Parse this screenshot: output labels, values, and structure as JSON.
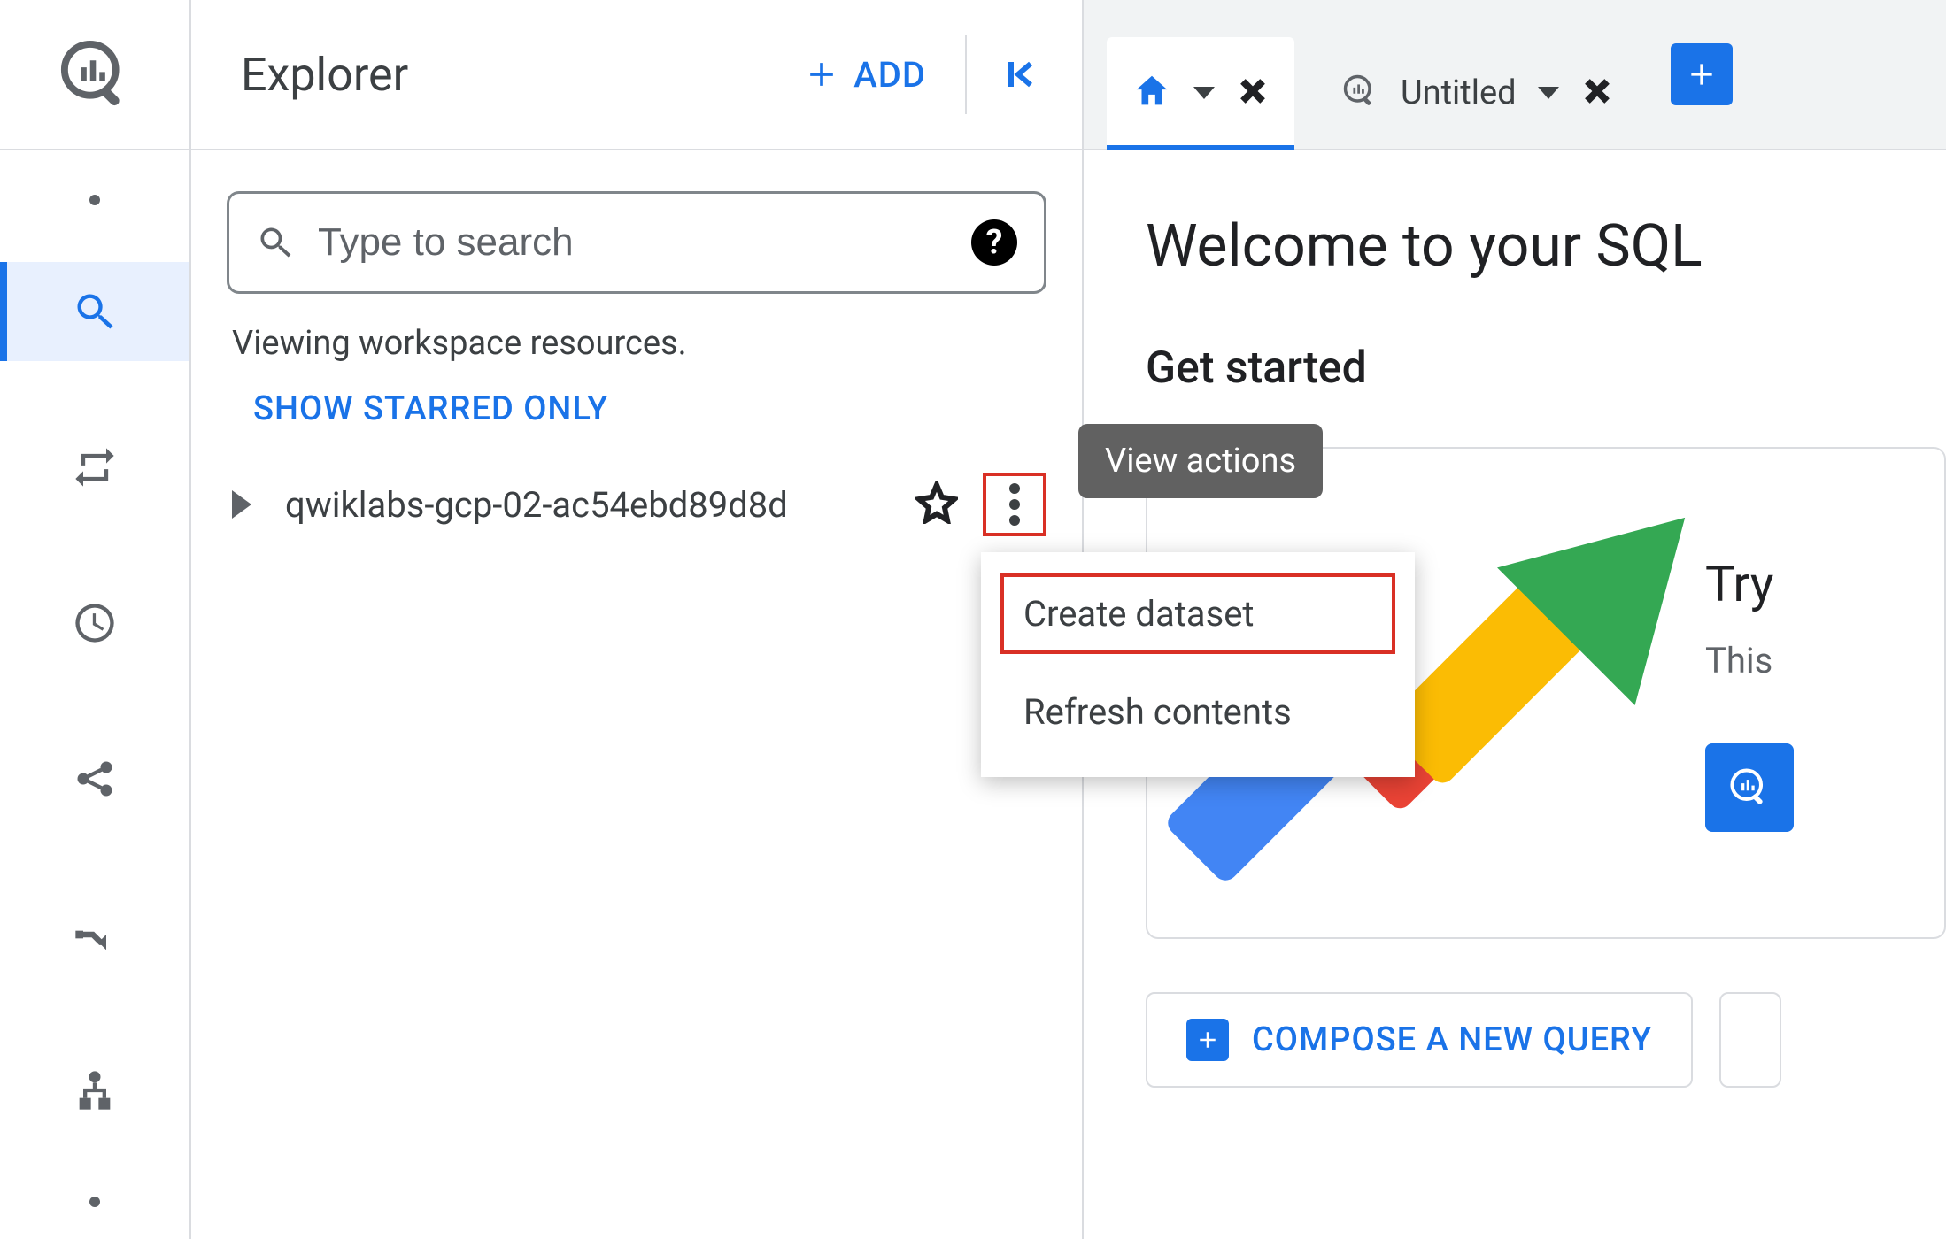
{
  "rail": {
    "items": [
      "dot",
      "search",
      "transfer",
      "history",
      "share",
      "pipeline",
      "tree",
      "dot"
    ]
  },
  "explorer": {
    "title": "Explorer",
    "add_label": "ADD",
    "search_placeholder": "Type to search",
    "viewing_text": "Viewing workspace resources.",
    "show_starred": "SHOW STARRED ONLY",
    "project_name": "qwiklabs-gcp-02-ac54ebd89d8d"
  },
  "tabs": {
    "untitled_label": "Untitled"
  },
  "main": {
    "welcome": "Welcome to your SQL",
    "get_started": "Get started",
    "try_title": "Try",
    "try_sub": "This",
    "compose_label": "COMPOSE A NEW QUERY"
  },
  "tooltip": {
    "text": "View actions"
  },
  "menu": {
    "create_dataset": "Create dataset",
    "refresh_contents": "Refresh contents"
  }
}
